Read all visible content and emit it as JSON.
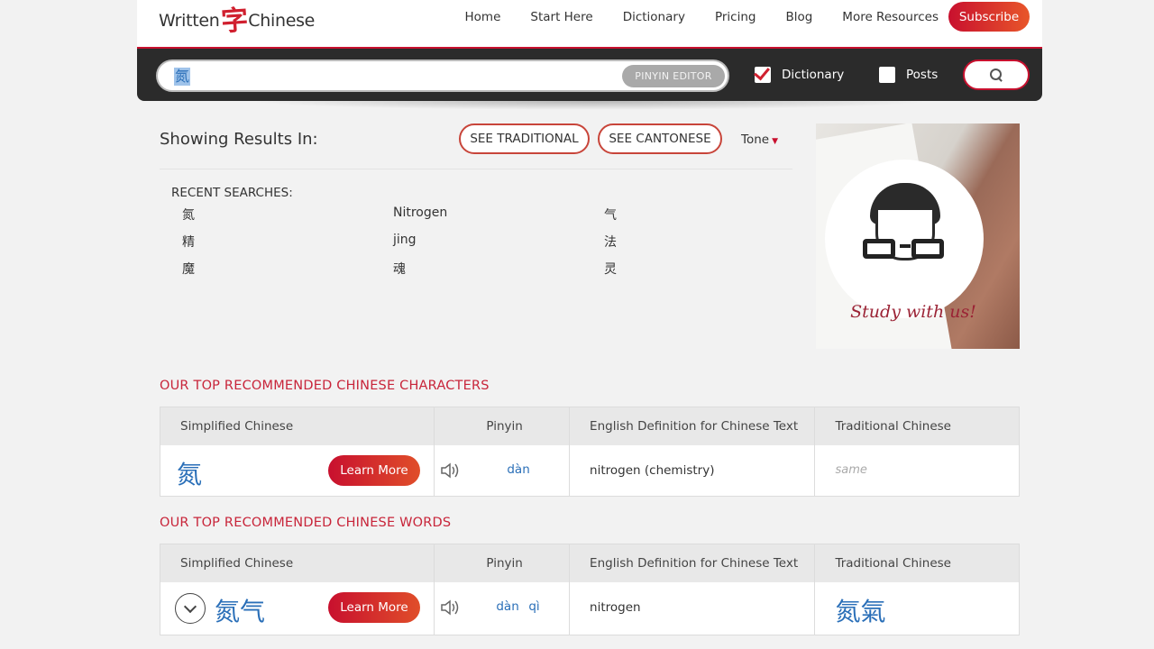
{
  "header": {
    "logo_left": "Written",
    "logo_mark": "字",
    "logo_right": "Chinese",
    "nav": [
      "Home",
      "Start Here",
      "Dictionary",
      "Pricing",
      "Blog",
      "More Resources"
    ],
    "subscribe_label": "Subscribe"
  },
  "search": {
    "value": "氮",
    "pinyin_editor_label": "PINYIN EDITOR",
    "dictionary_label": "Dictionary",
    "dictionary_checked": true,
    "posts_label": "Posts",
    "posts_checked": false,
    "search_icon": "search-icon"
  },
  "results": {
    "showing_label": "Showing Results In:",
    "see_traditional_label": "SEE TRADITIONAL",
    "see_cantonese_label": "SEE CANTONESE",
    "tone_label": "Tone",
    "recent_title": "RECENT SEARCHES:",
    "recent": [
      "氮",
      "Nitrogen",
      "气",
      "精",
      "jing",
      "法",
      "魔",
      "魂",
      "灵"
    ]
  },
  "ad": {
    "text": "Study with us!"
  },
  "characters_section": {
    "title": "OUR TOP RECOMMENDED CHINESE CHARACTERS",
    "headers": [
      "Simplified Chinese",
      "Pinyin",
      "English Definition for Chinese Text",
      "Traditional Chinese"
    ],
    "row": {
      "simplified": "氮",
      "learn_more": "Learn More",
      "pinyin": "dàn",
      "definition": "nitrogen (chemistry)",
      "traditional": "same"
    }
  },
  "words_section": {
    "title": "OUR TOP RECOMMENDED CHINESE WORDS",
    "headers": [
      "Simplified Chinese",
      "Pinyin",
      "English Definition for Chinese Text",
      "Traditional Chinese"
    ],
    "row": {
      "simplified": "氮气",
      "learn_more": "Learn More",
      "pinyin_1": "dàn",
      "pinyin_2": "qì",
      "definition": "nitrogen",
      "traditional": "氮氣"
    }
  },
  "colors": {
    "brand_red": "#c8102e",
    "link_blue": "#2a6fb8",
    "searchbar_dark": "#2b2b2b"
  }
}
